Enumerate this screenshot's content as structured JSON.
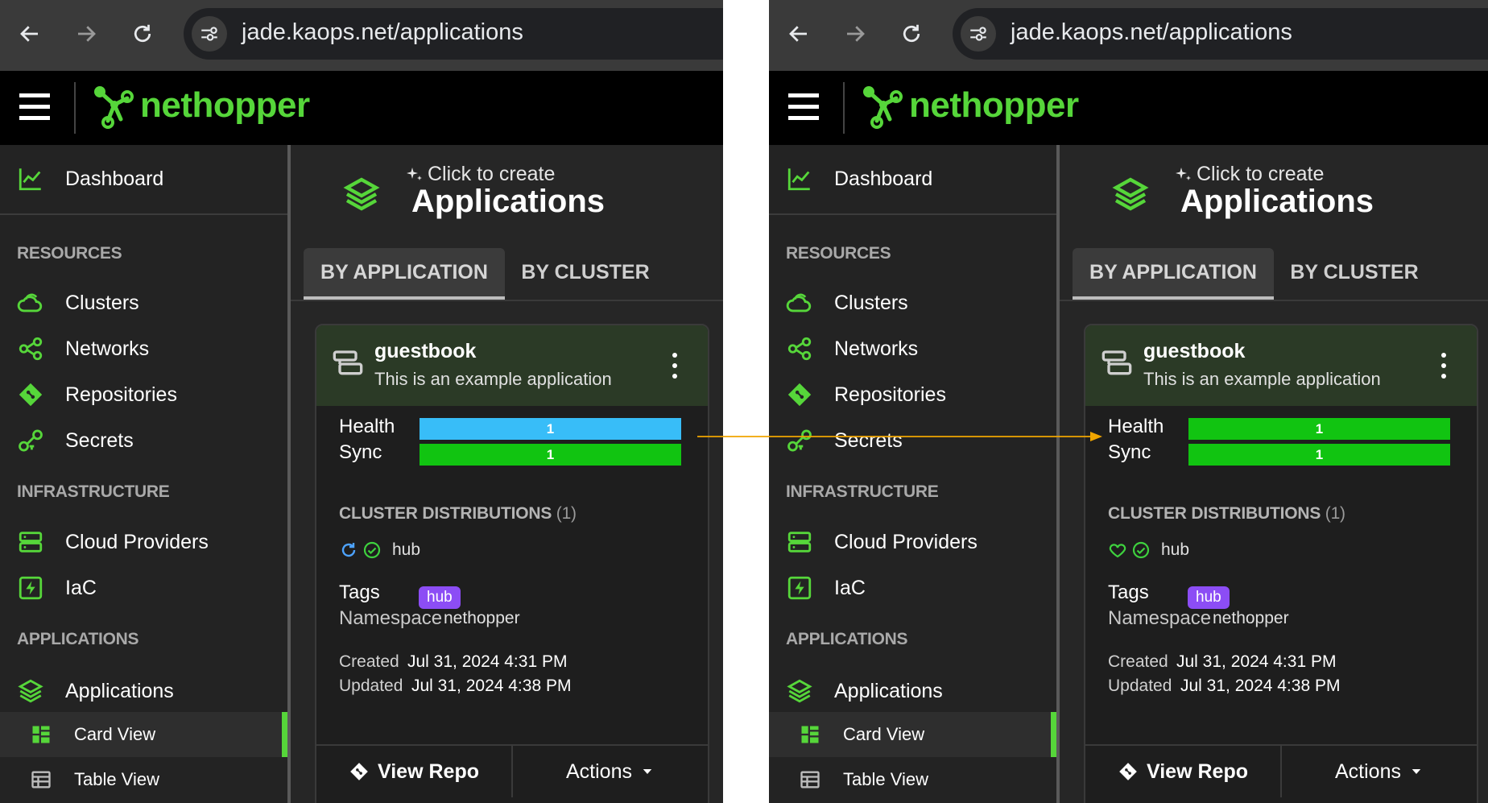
{
  "url": "jade.kaops.net/applications",
  "brand": "nethopper",
  "colors": {
    "brand_green": "#56d63a",
    "health_left": "#38bdf8",
    "health_right": "#11c411",
    "sync": "#11c411",
    "tag": "#8c4df5",
    "arrow": "#f0a500"
  },
  "sidebar": {
    "dashboard": "Dashboard",
    "resources_header": "RESOURCES",
    "clusters": "Clusters",
    "networks": "Networks",
    "repositories": "Repositories",
    "secrets": "Secrets",
    "infrastructure_header": "INFRASTRUCTURE",
    "cloud_providers": "Cloud Providers",
    "iac": "IaC",
    "applications_header": "APPLICATIONS",
    "applications": "Applications",
    "card_view": "Card View",
    "table_view": "Table View"
  },
  "page": {
    "hint": "Click to create",
    "title": "Applications",
    "tab_by_application": "BY APPLICATION",
    "tab_by_cluster": "BY CLUSTER"
  },
  "card": {
    "name": "guestbook",
    "description": "This is an example application",
    "health_label": "Health",
    "health_count": "1",
    "sync_label": "Sync",
    "sync_count": "1",
    "cluster_dist_label": "CLUSTER DISTRIBUTIONS",
    "cluster_dist_count": "(1)",
    "cluster_name": "hub",
    "tags_label": "Tags",
    "tag": "hub",
    "namespace_label": "Namespace",
    "namespace": "nethopper",
    "created_label": "Created",
    "created": "Jul 31, 2024 4:31 PM",
    "updated_label": "Updated",
    "updated": "Jul 31, 2024 4:38 PM",
    "view_repo": "View Repo",
    "actions": "Actions"
  },
  "panels": [
    {
      "id": "left",
      "health_status": "progressing",
      "health_color": "#38bdf8"
    },
    {
      "id": "right",
      "health_status": "healthy",
      "health_color": "#11c411"
    }
  ]
}
